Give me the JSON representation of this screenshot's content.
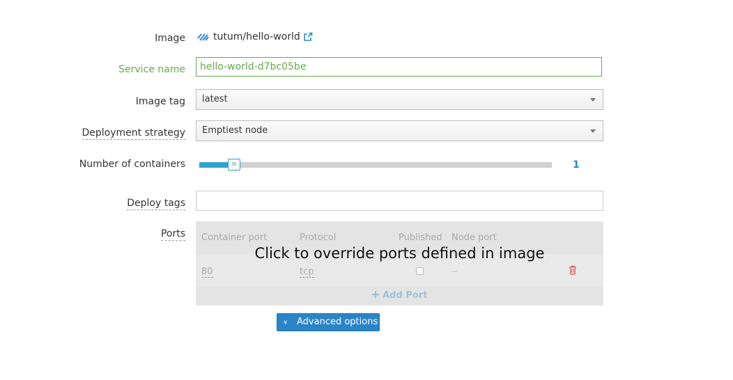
{
  "image": {
    "label": "Image",
    "name": "tutum/hello-world"
  },
  "service_name": {
    "label": "Service name",
    "value": "hello-world-d7bc05be"
  },
  "image_tag": {
    "label": "Image tag",
    "value": "latest"
  },
  "deployment_strategy": {
    "label": "Deployment strategy",
    "value": "Emptiest node"
  },
  "containers": {
    "label": "Number of containers",
    "value": "1",
    "handle_glyph": "III"
  },
  "deploy_tags": {
    "label": "Deploy tags",
    "value": ""
  },
  "ports": {
    "label": "Ports",
    "headers": [
      "Container port",
      "Protocol",
      "Published",
      "Node port"
    ],
    "rows": [
      {
        "container_port": "80",
        "protocol": "tcp",
        "published": false,
        "node_port": "--"
      }
    ],
    "add_label": "Add Port",
    "overlay_text": "Click to override ports defined in image"
  },
  "advanced_button": {
    "label": "Advanced options"
  },
  "colors": {
    "accent": "#2a85c8",
    "valid": "#6aa84f",
    "slider": "#2fa4cf",
    "danger": "#e05a5a"
  }
}
